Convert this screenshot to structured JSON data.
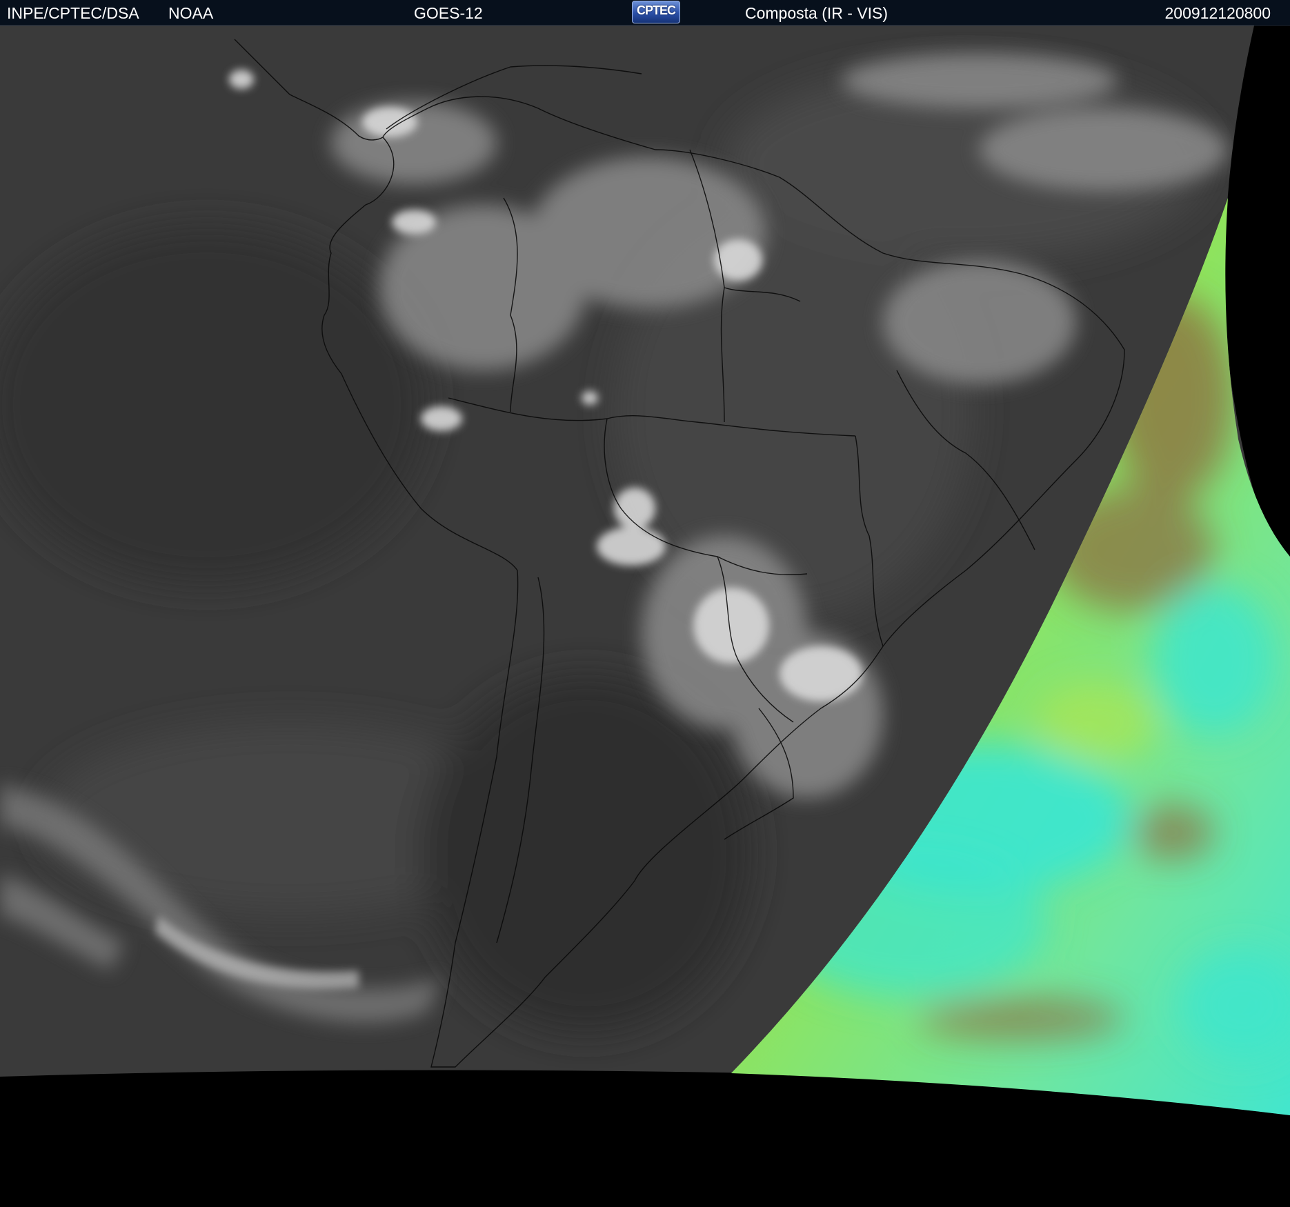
{
  "header": {
    "source": "INPE/CPTEC/DSA",
    "agency": "NOAA",
    "satellite": "GOES-12",
    "logo_text": "CPTEC",
    "product": "Composta (IR - VIS)",
    "timestamp": "200912120800"
  },
  "colors": {
    "header_background": "#07101c",
    "header_text": "#ffffff",
    "infrared_gray": "#3c3c3c",
    "cloud_white": "#e2e2e2",
    "visible_green": "#9fe84a",
    "visible_cyan": "#36e6cf",
    "visible_brown": "#8d6b3f",
    "space_black": "#000000",
    "boundary_lines": "#0a0a0a"
  },
  "layers": {
    "infrared": "IR",
    "visible": "VIS"
  }
}
